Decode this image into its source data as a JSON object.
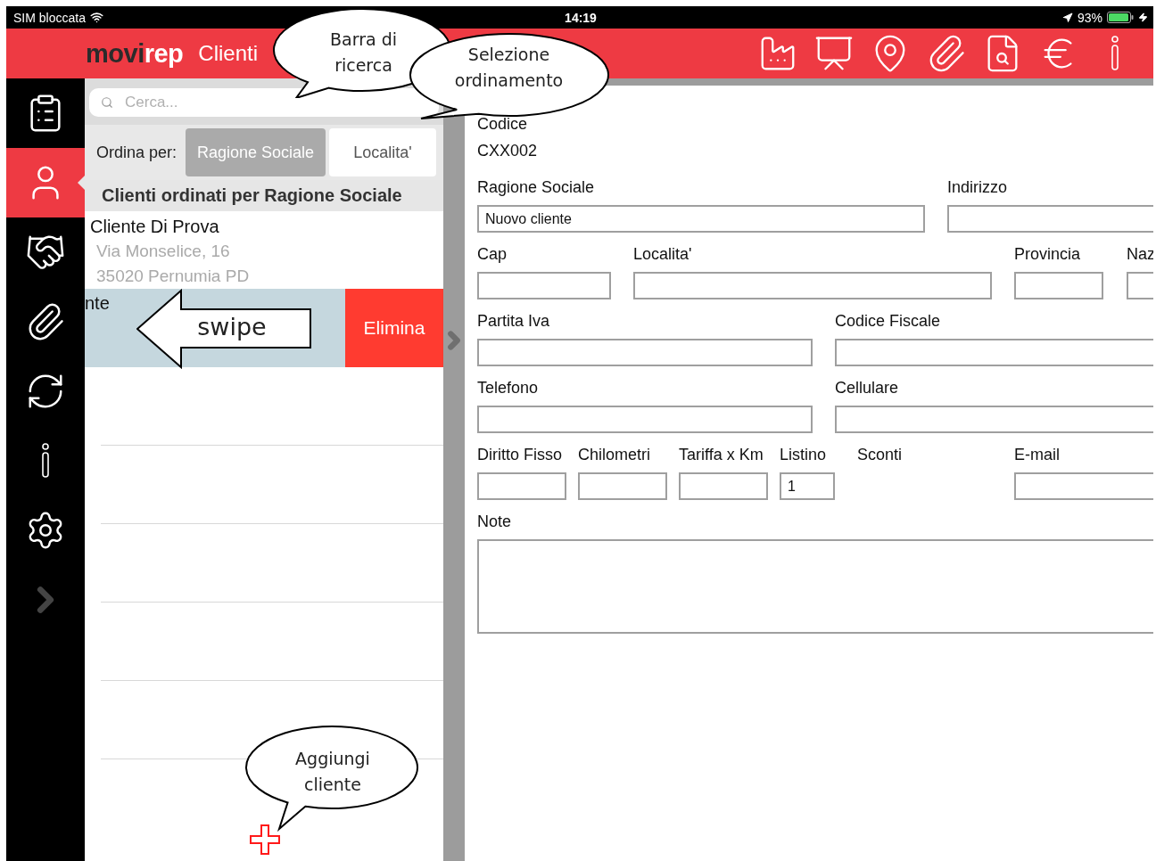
{
  "status_bar": {
    "carrier": "SIM bloccata",
    "time": "14:19",
    "battery": "93%"
  },
  "header": {
    "logo_dark": "movi",
    "logo_light": "rep",
    "title": "Clienti"
  },
  "sidebar": {
    "items": [
      {
        "kind": "clipboard",
        "selected": false
      },
      {
        "kind": "person",
        "selected": true
      },
      {
        "kind": "handshake",
        "selected": false
      },
      {
        "kind": "attachment",
        "selected": false
      },
      {
        "kind": "sync",
        "selected": false
      },
      {
        "kind": "info",
        "selected": false
      },
      {
        "kind": "settings",
        "selected": false
      },
      {
        "kind": "expand",
        "selected": false
      }
    ]
  },
  "client_list": {
    "search": {
      "placeholder": "Cerca..."
    },
    "sort_label": "Ordina per:",
    "sort_options": [
      {
        "label": "Ragione Sociale",
        "selected": true
      },
      {
        "label": "Localita'",
        "selected": false
      }
    ],
    "section_title": "Clienti ordinati per Ragione Sociale",
    "clients": [
      {
        "name": "Cliente Di Prova",
        "address": "Via Monselice, 16",
        "city": "35020 Pernumia PD"
      }
    ],
    "swiped_row": {
      "name": "nte",
      "action": "Elimina"
    }
  },
  "client_form": {
    "code_label": "Codice",
    "code_value": "CXX002",
    "field_groups": [
      {
        "fields": [
          {
            "label": "Ragione Sociale",
            "value": "Nuovo cliente",
            "kind": "input"
          },
          {
            "label": "Indirizzo",
            "kind": "input"
          }
        ]
      },
      {
        "fields": [
          {
            "label": "Cap",
            "kind": "input"
          },
          {
            "label": "Localita'",
            "kind": "input"
          },
          {
            "label": "Provincia",
            "kind": "input"
          },
          {
            "label": "Naz",
            "kind": "input"
          }
        ]
      },
      {
        "fields": [
          {
            "label": "Partita Iva",
            "kind": "input"
          },
          {
            "label": "Codice Fiscale",
            "kind": "input"
          }
        ]
      },
      {
        "fields": [
          {
            "label": "Telefono",
            "kind": "input"
          },
          {
            "label": "Cellulare",
            "kind": "input"
          }
        ]
      },
      {
        "fields": [
          {
            "label": "Diritto Fisso",
            "kind": "input"
          },
          {
            "label": "Chilometri",
            "kind": "input"
          },
          {
            "label": "Tariffa x Km",
            "kind": "input"
          },
          {
            "label": "Listino",
            "value": "1",
            "kind": "input"
          },
          {
            "label": "Sconti",
            "kind": "label"
          },
          {
            "label": "E-mail",
            "kind": "input"
          }
        ]
      },
      {
        "fields": [
          {
            "label": "Note",
            "kind": "textarea"
          }
        ]
      }
    ]
  },
  "annotations": [
    {
      "kind": "bubble",
      "lines": [
        "Barra di",
        "ricerca"
      ]
    },
    {
      "kind": "bubble",
      "lines": [
        "Selezione",
        "ordinamento"
      ]
    },
    {
      "kind": "arrow",
      "lines": [
        "swipe"
      ]
    },
    {
      "kind": "bubble",
      "lines": [
        "Aggiungi",
        "cliente"
      ]
    }
  ]
}
